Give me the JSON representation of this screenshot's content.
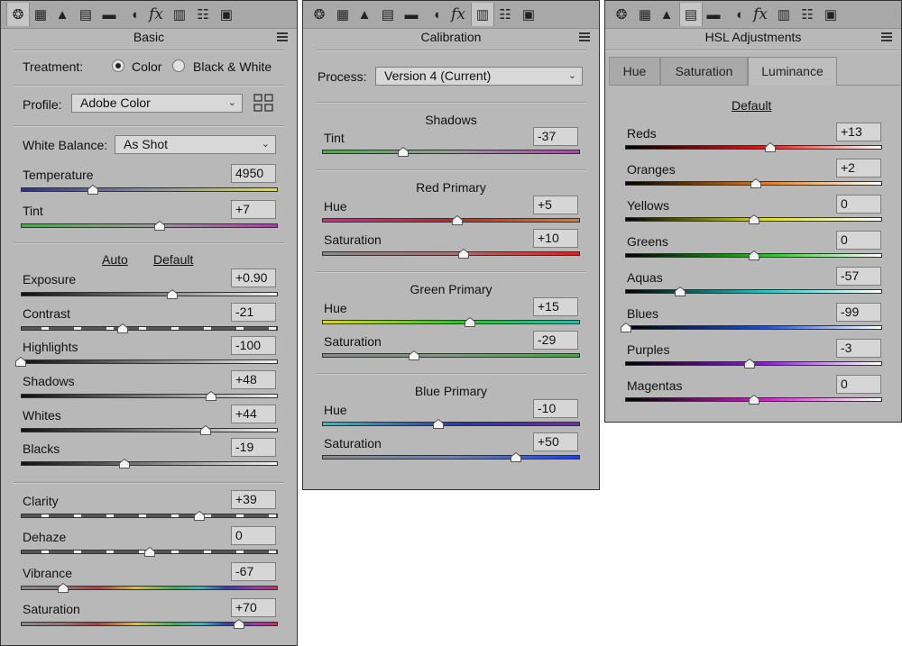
{
  "toolbar": {
    "icons": [
      "aperture-icon",
      "grid-icon",
      "mountain-icon",
      "split-icon",
      "minus-icon",
      "lens-icon",
      "fx-icon",
      "filmstrip-icon",
      "sliders-icon",
      "presets-icon"
    ],
    "fx_label": "fx"
  },
  "basic": {
    "title": "Basic",
    "treatment": {
      "label": "Treatment:",
      "option_color": "Color",
      "option_bw": "Black & White",
      "selected": "Color"
    },
    "profile": {
      "label": "Profile:",
      "value": "Adobe Color"
    },
    "white_balance": {
      "label": "White Balance:",
      "value": "As Shot"
    },
    "auto_label": "Auto",
    "default_label": "Default",
    "sliders": [
      {
        "label": "Temperature",
        "value": "4950",
        "pos": 0.28,
        "gradient": "temperature"
      },
      {
        "label": "Tint",
        "value": "+7",
        "pos": 0.54,
        "gradient": "tint"
      },
      {
        "label": "Exposure",
        "value": "+0.90",
        "pos": 0.59,
        "gradient": "gray"
      },
      {
        "label": "Contrast",
        "value": "-21",
        "pos": 0.395,
        "gradient": "dotted"
      },
      {
        "label": "Highlights",
        "value": "-100",
        "pos": 0.0,
        "gradient": "gray"
      },
      {
        "label": "Shadows",
        "value": "+48",
        "pos": 0.74,
        "gradient": "gray"
      },
      {
        "label": "Whites",
        "value": "+44",
        "pos": 0.72,
        "gradient": "gray"
      },
      {
        "label": "Blacks",
        "value": "-19",
        "pos": 0.405,
        "gradient": "gray"
      },
      {
        "label": "Clarity",
        "value": "+39",
        "pos": 0.695,
        "gradient": "dotted"
      },
      {
        "label": "Dehaze",
        "value": "0",
        "pos": 0.5,
        "gradient": "dotted"
      },
      {
        "label": "Vibrance",
        "value": "-67",
        "pos": 0.165,
        "gradient": "spectrum"
      },
      {
        "label": "Saturation",
        "value": "+70",
        "pos": 0.85,
        "gradient": "spectrum"
      }
    ]
  },
  "calibration": {
    "title": "Calibration",
    "process": {
      "label": "Process:",
      "value": "Version 4 (Current)"
    },
    "shadows": {
      "title": "Shadows",
      "tint": {
        "label": "Tint",
        "value": "-37",
        "pos": 0.315
      }
    },
    "red_primary": {
      "title": "Red Primary",
      "hue": {
        "label": "Hue",
        "value": "+5",
        "pos": 0.525
      },
      "saturation": {
        "label": "Saturation",
        "value": "+10",
        "pos": 0.55
      }
    },
    "green_primary": {
      "title": "Green Primary",
      "hue": {
        "label": "Hue",
        "value": "+15",
        "pos": 0.575
      },
      "saturation": {
        "label": "Saturation",
        "value": "-29",
        "pos": 0.355
      }
    },
    "blue_primary": {
      "title": "Blue Primary",
      "hue": {
        "label": "Hue",
        "value": "-10",
        "pos": 0.45
      },
      "saturation": {
        "label": "Saturation",
        "value": "+50",
        "pos": 0.75
      }
    }
  },
  "hsl": {
    "title": "HSL Adjustments",
    "tabs": [
      "Hue",
      "Saturation",
      "Luminance"
    ],
    "active_tab": "Luminance",
    "default_label": "Default",
    "sliders": [
      {
        "label": "Reds",
        "value": "+13",
        "pos": 0.565,
        "gradient": "reds"
      },
      {
        "label": "Oranges",
        "value": "+2",
        "pos": 0.51,
        "gradient": "oranges"
      },
      {
        "label": "Yellows",
        "value": "0",
        "pos": 0.5,
        "gradient": "yellows"
      },
      {
        "label": "Greens",
        "value": "0",
        "pos": 0.5,
        "gradient": "greens"
      },
      {
        "label": "Aquas",
        "value": "-57",
        "pos": 0.215,
        "gradient": "aquas"
      },
      {
        "label": "Blues",
        "value": "-99",
        "pos": 0.005,
        "gradient": "blues"
      },
      {
        "label": "Purples",
        "value": "-3",
        "pos": 0.485,
        "gradient": "purples"
      },
      {
        "label": "Magentas",
        "value": "0",
        "pos": 0.5,
        "gradient": "magentas"
      }
    ]
  }
}
